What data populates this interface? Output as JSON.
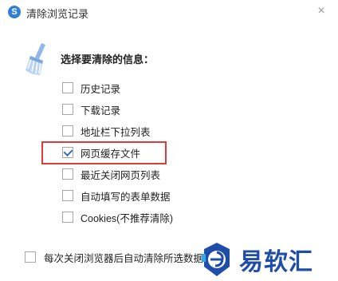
{
  "window": {
    "title": "清除浏览记录",
    "close_glyph": "×",
    "app_icon": "browser-logo-icon"
  },
  "section": {
    "heading": "选择要清除的信息：",
    "icon": "broom-icon"
  },
  "options": [
    {
      "label": "历史记录",
      "checked": false
    },
    {
      "label": "下载记录",
      "checked": false
    },
    {
      "label": "地址栏下拉列表",
      "checked": false
    },
    {
      "label": "网页缓存文件",
      "checked": true
    },
    {
      "label": "最近关闭网页列表",
      "checked": false
    },
    {
      "label": "自动填写的表单数据",
      "checked": false
    },
    {
      "label": "Cookies(不推荐清除)",
      "checked": false
    }
  ],
  "footer": {
    "auto_clear_label": "每次关闭浏览器后自动清除所选数据",
    "checked": false
  },
  "watermark": {
    "text": "易软汇"
  },
  "colors": {
    "highlight": "#e03a3a",
    "check": "#2e6fc7",
    "brand": "#1f4ea8"
  }
}
